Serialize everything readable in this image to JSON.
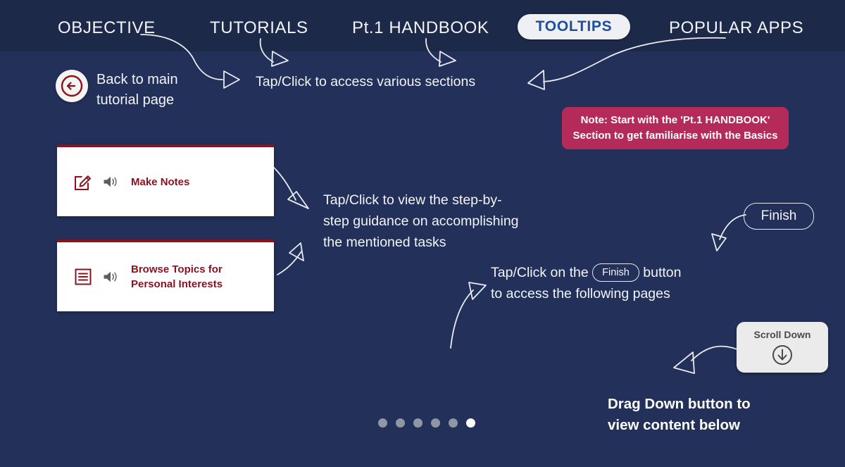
{
  "theme": {
    "background": "#22305a",
    "header_band": "#1d2949",
    "accent_red": "#8c1220",
    "note_pink": "#b42a59",
    "active_tab_text": "#1d4f9e",
    "text_light": "#f2f4f8"
  },
  "nav": {
    "items": [
      {
        "label": "OBJECTIVE",
        "active": false
      },
      {
        "label": "TUTORIALS",
        "active": false
      },
      {
        "label": "Pt.1 HANDBOOK",
        "active": false
      },
      {
        "label": "TOOLTIPS",
        "active": true
      },
      {
        "label": "POPULAR APPS",
        "active": false
      }
    ]
  },
  "back": {
    "icon": "back-arrow-circle-icon",
    "label_line1": "Back to main",
    "label_line2": "tutorial page"
  },
  "annotations": {
    "nav_hint": "Tap/Click to access various sections",
    "cards_hint_line1": "Tap/Click to view the step-by-",
    "cards_hint_line2": "step guidance on accomplishing",
    "cards_hint_line3": "the mentioned tasks",
    "finish_hint_prefix": "Tap/Click on the",
    "finish_hint_pill": "Finish",
    "finish_hint_suffix": "button",
    "finish_hint_line2": "to access the following pages",
    "drag_down_line1": "Drag Down button to",
    "drag_down_line2": "view content below"
  },
  "note": {
    "line1": "Note: Start with the 'Pt.1 HANDBOOK'",
    "line2": "Section to get familiarise with the Basics"
  },
  "cards": [
    {
      "icon": "edit-note-icon",
      "audio_icon": "speaker-icon",
      "title_line1": "Make Notes",
      "title_line2": ""
    },
    {
      "icon": "list-topics-icon",
      "audio_icon": "speaker-icon",
      "title_line1": "Browse Topics for",
      "title_line2": "Personal Interests"
    }
  ],
  "finish_button": {
    "label": "Finish"
  },
  "scroll_down": {
    "label": "Scroll Down",
    "icon": "arrow-down-circle-icon"
  },
  "pager": {
    "total": 6,
    "active_index": 5
  }
}
